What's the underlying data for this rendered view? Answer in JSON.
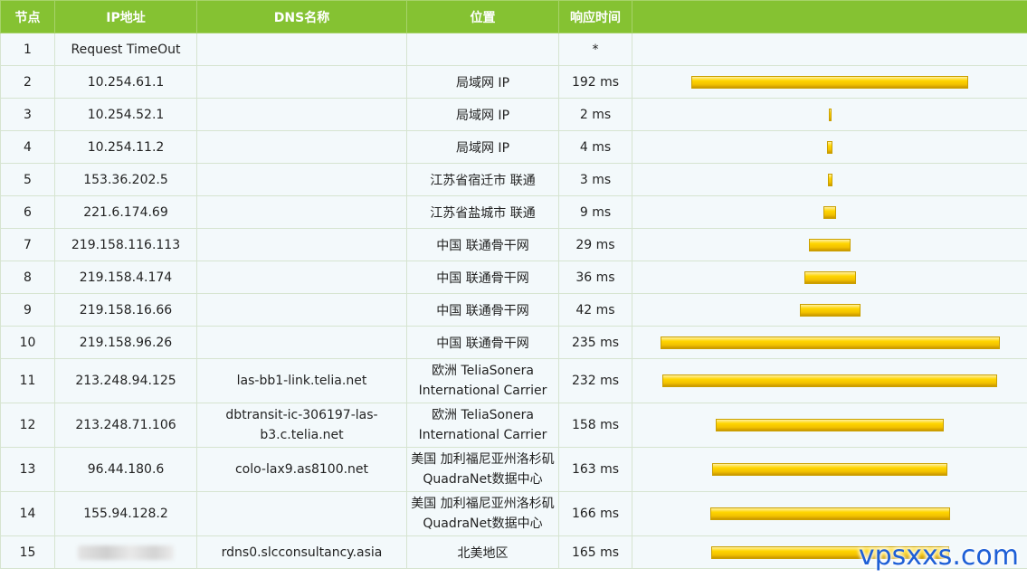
{
  "header": {
    "hop": "节点",
    "ip": "IP地址",
    "dns": "DNS名称",
    "location": "位置",
    "latency": "响应时间"
  },
  "rows": [
    {
      "hop": "1",
      "ip": "Request TimeOut",
      "dns": "",
      "location": "",
      "latency": "*",
      "ms": 0
    },
    {
      "hop": "2",
      "ip": "10.254.61.1",
      "dns": "",
      "location": "局域网 IP",
      "latency": "192 ms",
      "ms": 192
    },
    {
      "hop": "3",
      "ip": "10.254.52.1",
      "dns": "",
      "location": "局域网 IP",
      "latency": "2 ms",
      "ms": 2
    },
    {
      "hop": "4",
      "ip": "10.254.11.2",
      "dns": "",
      "location": "局域网 IP",
      "latency": "4 ms",
      "ms": 4
    },
    {
      "hop": "5",
      "ip": "153.36.202.5",
      "dns": "",
      "location": "江苏省宿迁市 联通",
      "latency": "3 ms",
      "ms": 3
    },
    {
      "hop": "6",
      "ip": "221.6.174.69",
      "dns": "",
      "location": "江苏省盐城市 联通",
      "latency": "9 ms",
      "ms": 9
    },
    {
      "hop": "7",
      "ip": "219.158.116.113",
      "dns": "",
      "location": "中国 联通骨干网",
      "latency": "29 ms",
      "ms": 29
    },
    {
      "hop": "8",
      "ip": "219.158.4.174",
      "dns": "",
      "location": "中国 联通骨干网",
      "latency": "36 ms",
      "ms": 36
    },
    {
      "hop": "9",
      "ip": "219.158.16.66",
      "dns": "",
      "location": "中国 联通骨干网",
      "latency": "42 ms",
      "ms": 42
    },
    {
      "hop": "10",
      "ip": "219.158.96.26",
      "dns": "",
      "location": "中国 联通骨干网",
      "latency": "235 ms",
      "ms": 235
    },
    {
      "hop": "11",
      "ip": "213.248.94.125",
      "dns": "las-bb1-link.telia.net",
      "location": "欧洲 TeliaSonera International Carrier",
      "latency": "232 ms",
      "ms": 232
    },
    {
      "hop": "12",
      "ip": "213.248.71.106",
      "dns": "dbtransit-ic-306197-las-b3.c.telia.net",
      "location": "欧洲 TeliaSonera International Carrier",
      "latency": "158 ms",
      "ms": 158
    },
    {
      "hop": "13",
      "ip": "96.44.180.6",
      "dns": "colo-lax9.as8100.net",
      "location": "美国 加利福尼亚州洛杉矶QuadraNet数据中心",
      "latency": "163 ms",
      "ms": 163
    },
    {
      "hop": "14",
      "ip": "155.94.128.2",
      "dns": "",
      "location": "美国 加利福尼亚州洛杉矶QuadraNet数据中心",
      "latency": "166 ms",
      "ms": 166
    },
    {
      "hop": "15",
      "ip": "",
      "ip_blurred": true,
      "dns": "rdns0.slcconsultancy.asia",
      "location": "北美地区",
      "latency": "165 ms",
      "ms": 165
    }
  ],
  "bar_max_ms": 235,
  "watermark": "vpsxxs.com",
  "colors": {
    "header_bg": "#85c232",
    "row_bg": "#f3f9fb",
    "bar": "#ffd500",
    "watermark": "#1e5fd6"
  }
}
